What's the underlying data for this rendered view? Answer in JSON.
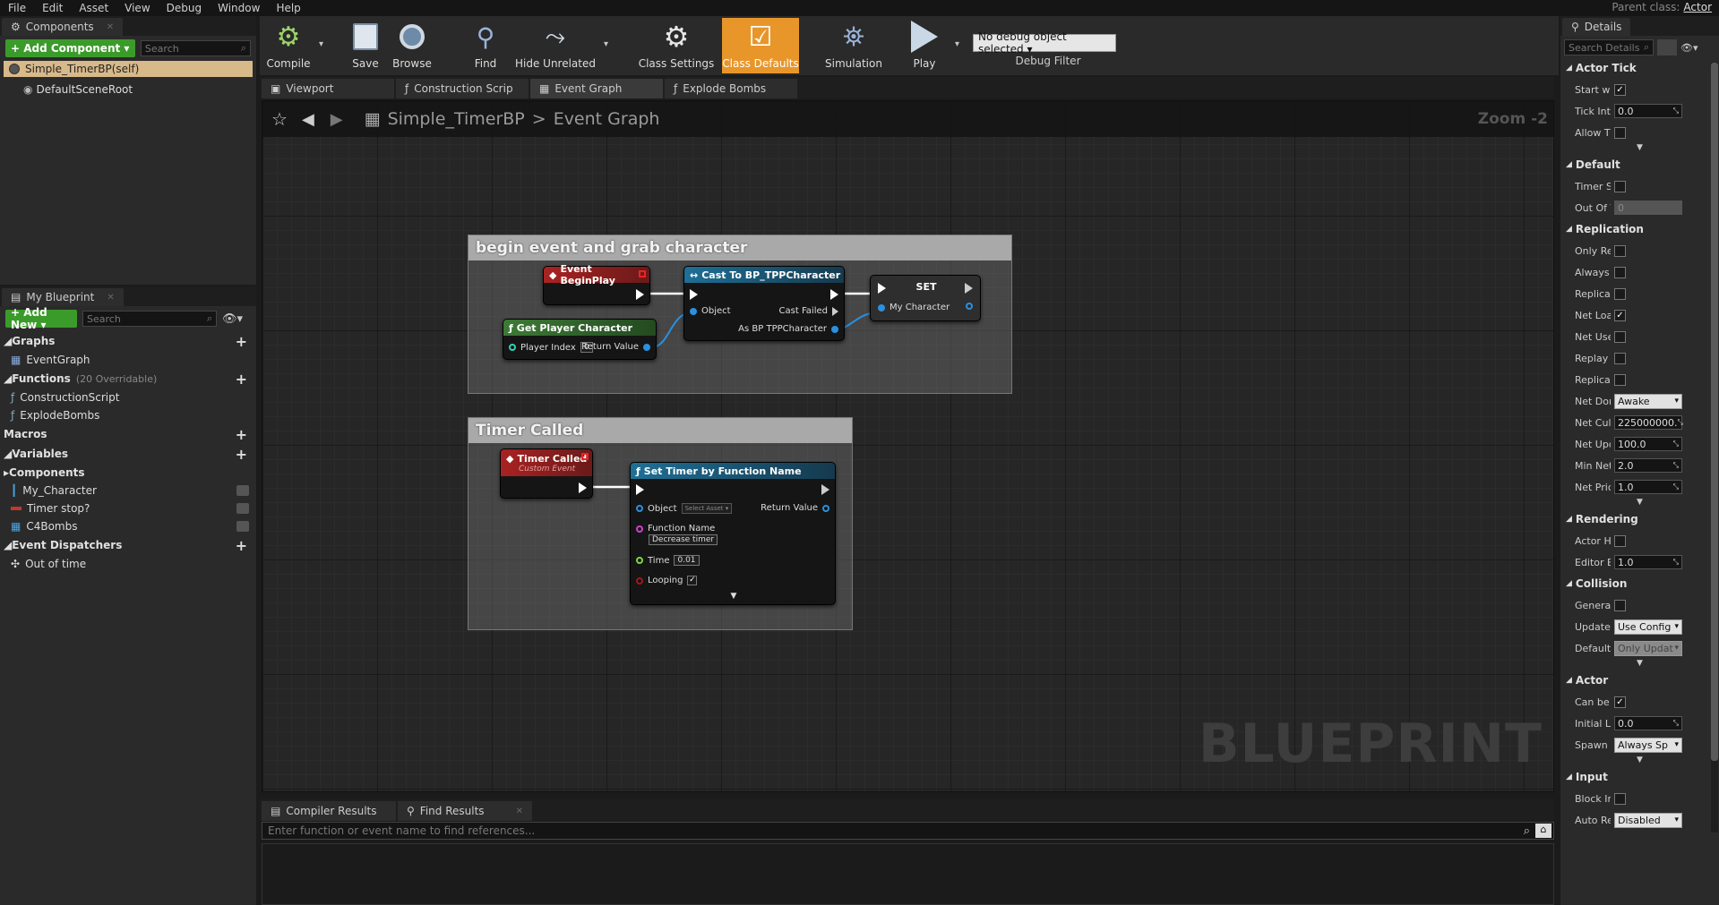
{
  "menu": [
    "File",
    "Edit",
    "Asset",
    "View",
    "Debug",
    "Window",
    "Help"
  ],
  "parent_class": {
    "label": "Parent class:",
    "value": "Actor"
  },
  "components_panel": {
    "tab": "Components",
    "add_button": "+ Add Component ▾",
    "search_placeholder": "Search",
    "self_item": "Simple_TimerBP(self)",
    "root_item": "DefaultSceneRoot"
  },
  "my_blueprint": {
    "tab": "My Blueprint",
    "add_new": "+ Add New ▾",
    "search_placeholder": "Search",
    "graphs_label": "Graphs",
    "graphs": [
      "EventGraph"
    ],
    "functions_label": "Functions",
    "functions_sub": "(20 Overridable)",
    "functions": [
      "ConstructionScript",
      "ExplodeBombs"
    ],
    "macros_label": "Macros",
    "variables_label": "Variables",
    "components_label": "Components",
    "variables": [
      "My_Character",
      "Timer stop?",
      "C4Bombs"
    ],
    "dispatchers_label": "Event Dispatchers",
    "dispatchers": [
      "Out of time"
    ]
  },
  "toolbar": {
    "compile": "Compile",
    "save": "Save",
    "browse": "Browse",
    "find": "Find",
    "hide_unrelated": "Hide Unrelated",
    "class_settings": "Class Settings",
    "class_defaults": "Class Defaults",
    "simulation": "Simulation",
    "play": "Play",
    "debug_select": "No debug object selected ▾",
    "debug_filter": "Debug Filter"
  },
  "editor_tabs": [
    "Viewport",
    "Construction Scrip",
    "Event Graph",
    "Explode Bombs"
  ],
  "graph": {
    "breadcrumb_bp": "Simple_TimerBP",
    "breadcrumb_sep": ">",
    "breadcrumb_graph": "Event Graph",
    "zoom": "Zoom -2",
    "watermark": "BLUEPRINT",
    "comment1": "begin event and grab character",
    "comment2": "Timer Called",
    "nodes": {
      "begin_play": "Event BeginPlay",
      "cast": "Cast To BP_TPPCharacter",
      "cast_object": "Object",
      "cast_failed": "Cast Failed",
      "cast_as": "As BP TPPCharacter",
      "set": "SET",
      "set_var": "My Character",
      "get_player": "Get Player Character",
      "player_index": "Player Index",
      "player_index_val": "0",
      "return_value": "Return Value",
      "timer_called": "Timer Called",
      "timer_called_sub": "Custom Event",
      "set_timer": "Set Timer by Function Name",
      "st_object": "Object",
      "st_object_val": "Select Asset ▾",
      "st_return": "Return Value",
      "st_function_name": "Function Name",
      "st_function_val": "Decrease timer",
      "st_time": "Time",
      "st_time_val": "0.01",
      "st_looping": "Looping"
    }
  },
  "bottom": {
    "tabs": [
      "Compiler Results",
      "Find Results"
    ],
    "find_placeholder": "Enter function or event name to find references..."
  },
  "details": {
    "tab": "Details",
    "search_placeholder": "Search Details",
    "sections": [
      {
        "title": "Actor Tick",
        "rows": [
          {
            "label": "Start wi",
            "type": "check",
            "checked": true
          },
          {
            "label": "Tick Int",
            "type": "num",
            "value": "0.0"
          },
          {
            "label": "Allow Ti",
            "type": "check",
            "checked": false
          }
        ],
        "more": true
      },
      {
        "title": "Default",
        "rows": [
          {
            "label": "Timer S",
            "type": "check",
            "checked": false
          },
          {
            "label": "Out Of T",
            "type": "numdis",
            "value": "0"
          }
        ],
        "more": false
      },
      {
        "title": "Replication",
        "rows": [
          {
            "label": "Only Re",
            "type": "check",
            "checked": false
          },
          {
            "label": "Always",
            "type": "check",
            "checked": false
          },
          {
            "label": "Replicat",
            "type": "check",
            "checked": false
          },
          {
            "label": "Net Loa",
            "type": "check",
            "checked": true
          },
          {
            "label": "Net Use",
            "type": "check",
            "checked": false
          },
          {
            "label": "Replay I",
            "type": "check",
            "checked": false
          },
          {
            "label": "Replicat",
            "type": "check",
            "checked": false
          },
          {
            "label": "Net Dor",
            "type": "dd",
            "value": "Awake"
          },
          {
            "label": "Net Cull",
            "type": "num",
            "value": "225000000."
          },
          {
            "label": "Net Upd",
            "type": "num",
            "value": "100.0"
          },
          {
            "label": "Min Net",
            "type": "num",
            "value": "2.0"
          },
          {
            "label": "Net Pric",
            "type": "num",
            "value": "1.0"
          }
        ],
        "more": true
      },
      {
        "title": "Rendering",
        "rows": [
          {
            "label": "Actor H",
            "type": "check",
            "checked": false
          },
          {
            "label": "Editor B",
            "type": "num",
            "value": "1.0"
          }
        ],
        "more": false
      },
      {
        "title": "Collision",
        "rows": [
          {
            "label": "Generat",
            "type": "check",
            "checked": false
          },
          {
            "label": "Update",
            "type": "dd",
            "value": "Use Config"
          },
          {
            "label": "Default",
            "type": "dddis",
            "value": "Only Updat"
          }
        ],
        "more": true
      },
      {
        "title": "Actor",
        "rows": [
          {
            "label": "Can be I",
            "type": "check",
            "checked": true
          },
          {
            "label": "Initial Li",
            "type": "num",
            "value": "0.0"
          },
          {
            "label": "Spawn C",
            "type": "dd",
            "value": "Always Sp"
          }
        ],
        "more": true
      },
      {
        "title": "Input",
        "rows": [
          {
            "label": "Block In",
            "type": "check",
            "checked": false
          },
          {
            "label": "Auto Re",
            "type": "dd",
            "value": "Disabled"
          }
        ],
        "more": false
      }
    ]
  },
  "colors": {
    "event_red": "#8c1d1d",
    "cast_blue": "#1e5a7a",
    "function_green": "#2f5e2a",
    "accent_orange": "#e8962a",
    "self_highlight": "#d8b98a"
  }
}
